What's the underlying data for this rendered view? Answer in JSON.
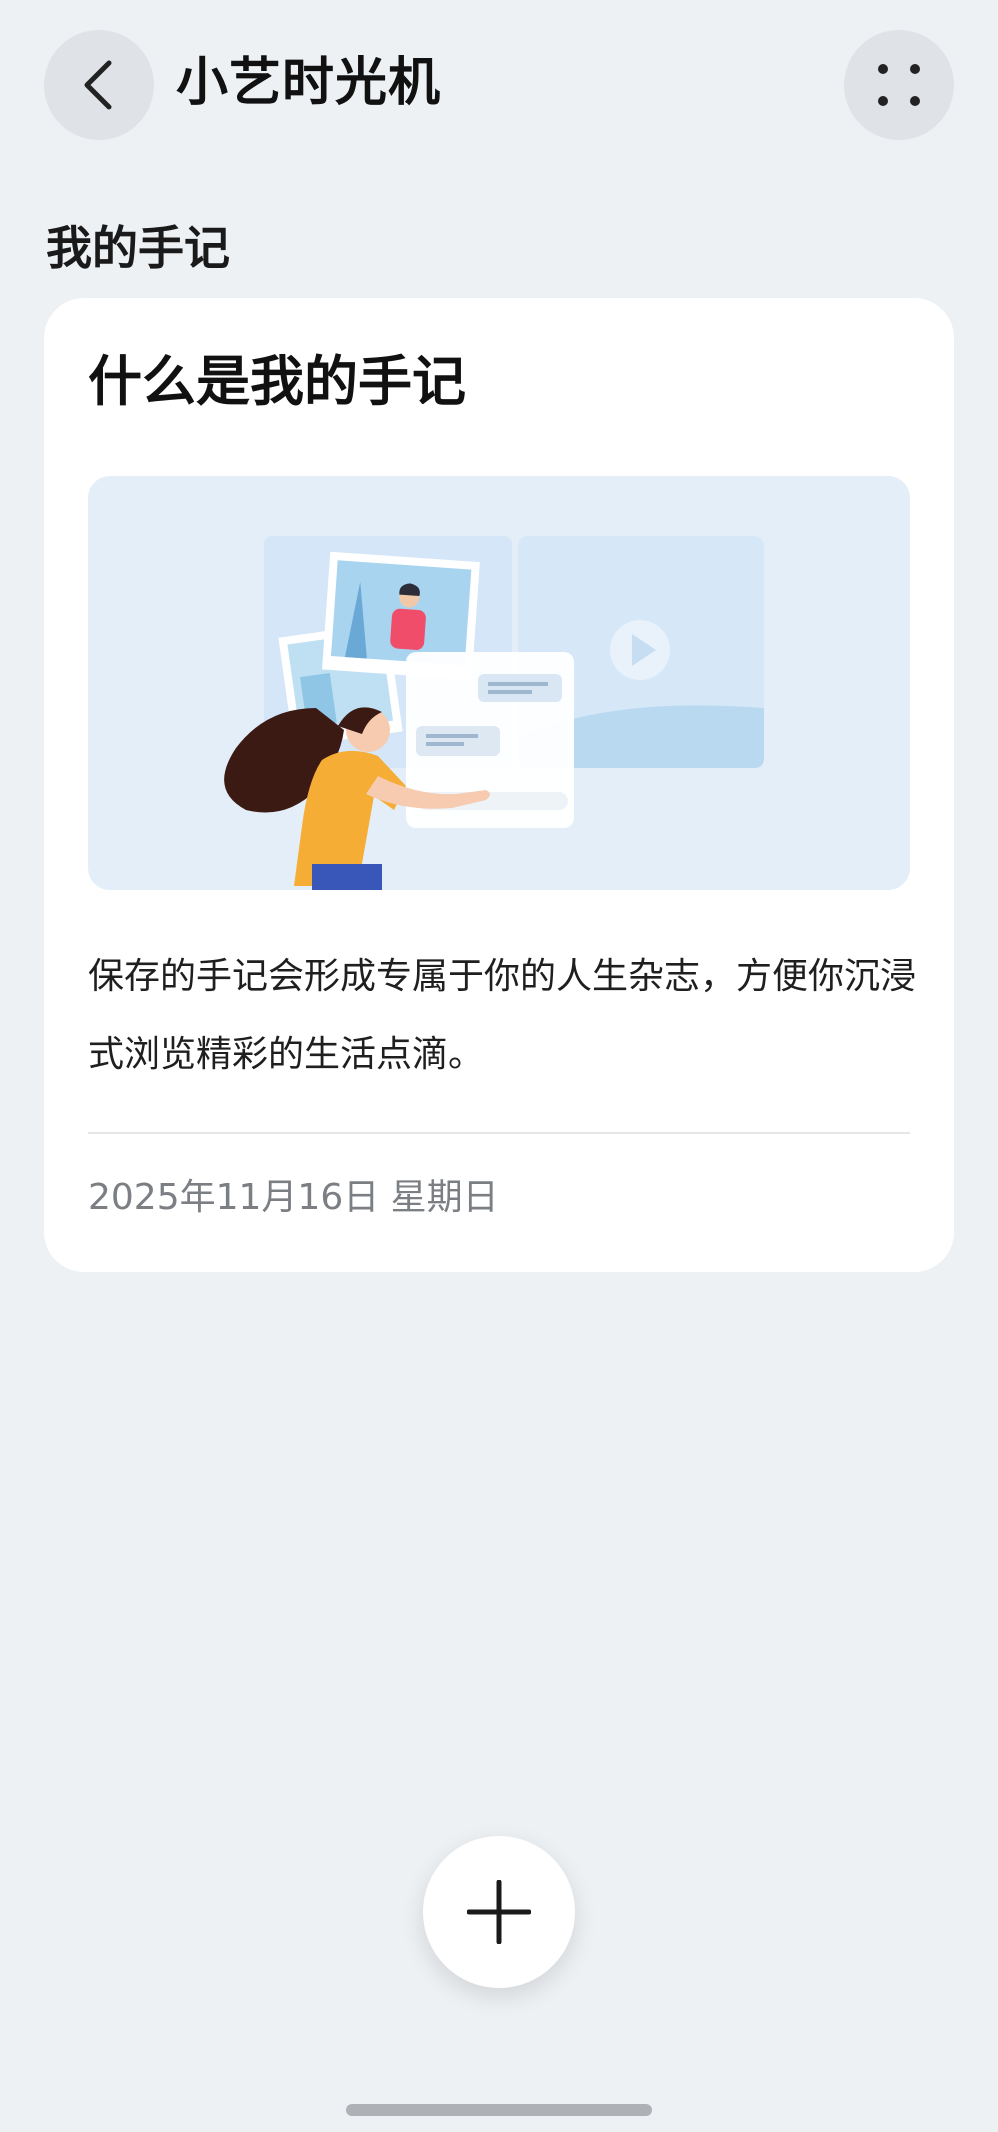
{
  "header": {
    "title": "小艺时光机",
    "back_icon": "chevron-left-icon",
    "more_icon": "more-dots-icon"
  },
  "section": {
    "title": "我的手记"
  },
  "card": {
    "title": "什么是我的手记",
    "description": "保存的手记会形成专属于你的人生杂志，方便你沉浸式浏览精彩的生活点滴。",
    "date": "2025年11月16日 星期日"
  },
  "fab": {
    "icon": "plus-icon"
  },
  "colors": {
    "background": "#eef1f4",
    "card": "#ffffff",
    "illustration_bg": "#e3eef9",
    "date_text": "#7b7f84"
  }
}
